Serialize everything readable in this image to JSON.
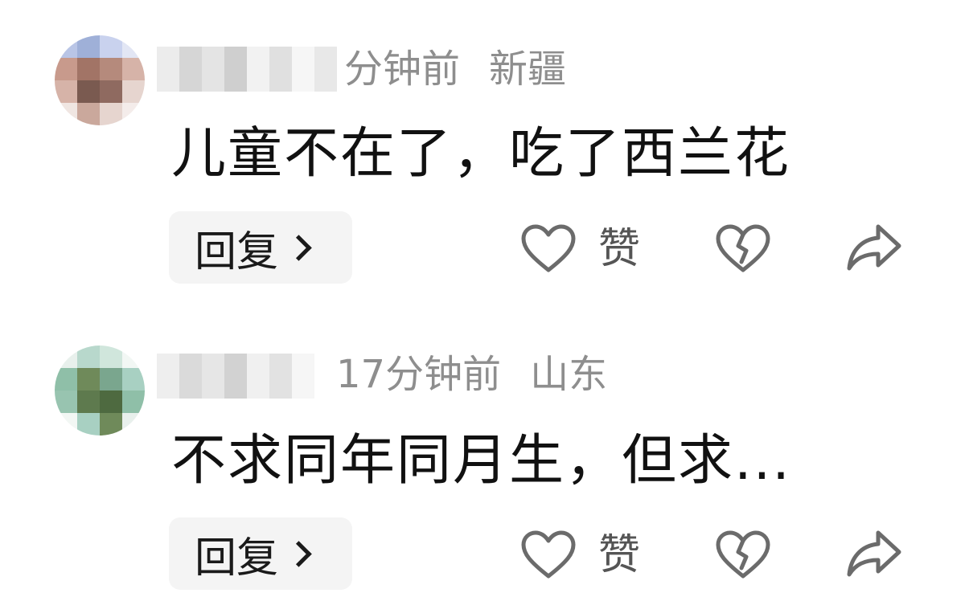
{
  "comments": [
    {
      "time": "分钟前",
      "location": "新疆",
      "text": "儿童不在了，吃了西兰花",
      "reply_label": "回复",
      "like_label": "赞",
      "avatar_colors": [
        "#9fb0d8",
        "#c89a8c",
        "#a27466",
        "#d6b3a8",
        "#7a5a50",
        "#b58a7c",
        "#e6d5cf",
        "#8f6a60",
        "#caa89c"
      ]
    },
    {
      "time": "17分钟前",
      "location": "山东",
      "text": "不求同年同月生，但求...",
      "reply_label": "回复",
      "like_label": "赞",
      "avatar_colors": [
        "#8fbfa8",
        "#6f8a5a",
        "#a8d0c2",
        "#5e7a4e",
        "#7aa68e",
        "#b8d8cc",
        "#4e6a40",
        "#98c4b0",
        "#d0e6dc"
      ]
    }
  ],
  "icons": {
    "like": "heart-outline-icon",
    "dislike": "broken-heart-icon",
    "share": "share-arrow-icon"
  },
  "colors": {
    "meta_text": "#8e8e8e",
    "content_text": "#111111",
    "icon_stroke": "#6b6b6b",
    "reply_bg": "#f4f4f4"
  }
}
